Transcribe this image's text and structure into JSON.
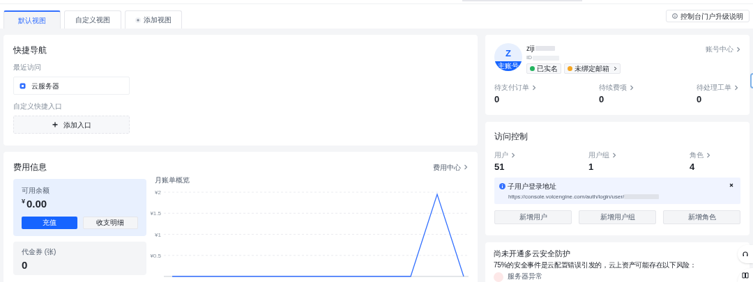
{
  "tabs": [
    {
      "label": "默认视图",
      "selected": true,
      "kind": "view"
    },
    {
      "label": "自定义视图",
      "selected": false,
      "kind": "view"
    },
    {
      "label": "添加视图",
      "selected": false,
      "kind": "add"
    }
  ],
  "upgrade_button": "控制台门户升级说明",
  "quick_nav": {
    "title": "快捷导航",
    "recent_label": "最近访问",
    "recent_items": [
      "云服务器"
    ],
    "custom_label": "自定义快捷入口",
    "add_entry": "添加入口"
  },
  "fees": {
    "title": "费用信息",
    "center_link": "费用中心",
    "balance": {
      "label": "可用余额",
      "currency": "¥",
      "amount": "0.00",
      "primary_button": "充值",
      "secondary_button": "收支明细"
    },
    "vouchers": {
      "label": "代金券 (张)",
      "value": "0"
    },
    "chart_title": "月账单概览",
    "chart_data": {
      "type": "line",
      "grid": true,
      "ylim": [
        0,
        2
      ],
      "yticks": [
        {
          "value": 0.5,
          "label": "¥0.5"
        },
        {
          "value": 1,
          "label": "¥1"
        },
        {
          "value": 1.5,
          "label": "¥1.5"
        },
        {
          "value": 2,
          "label": "¥2"
        }
      ],
      "series": [
        {
          "color": "#3370ff",
          "values": [
            0,
            0,
            0,
            0,
            0,
            0,
            0,
            0,
            0,
            0,
            1.95,
            0
          ]
        }
      ]
    }
  },
  "account": {
    "avatar_letter": "Z",
    "avatar_badge": "主账号",
    "name": "ziji",
    "id_label": "ID",
    "account_center": "账号中心",
    "tags": [
      {
        "label": "已实名",
        "color": "#22b35e",
        "arrow": false
      },
      {
        "label": "未绑定邮箱",
        "color": "#f5a623",
        "arrow": true
      }
    ],
    "stats": [
      {
        "label": "待支付订单",
        "value": "0"
      },
      {
        "label": "待续费项",
        "value": "0"
      },
      {
        "label": "待处理工单",
        "value": "0"
      }
    ]
  },
  "access_control": {
    "title": "访问控制",
    "stats": [
      {
        "label": "用户",
        "value": "51"
      },
      {
        "label": "用户组",
        "value": "1"
      },
      {
        "label": "角色",
        "value": "4"
      }
    ],
    "notice": {
      "title": "子用户登录地址",
      "url": "https://console.volcengine.com/auth/login/user/"
    },
    "buttons": [
      "新增用户",
      "新增用户组",
      "新增角色"
    ]
  },
  "security": {
    "title": "尚未开通多云安全防护",
    "description": "75%的安全事件是云配置错误引发的，云上资产可能存在以下风险：",
    "risks": [
      "服务器异常"
    ]
  }
}
